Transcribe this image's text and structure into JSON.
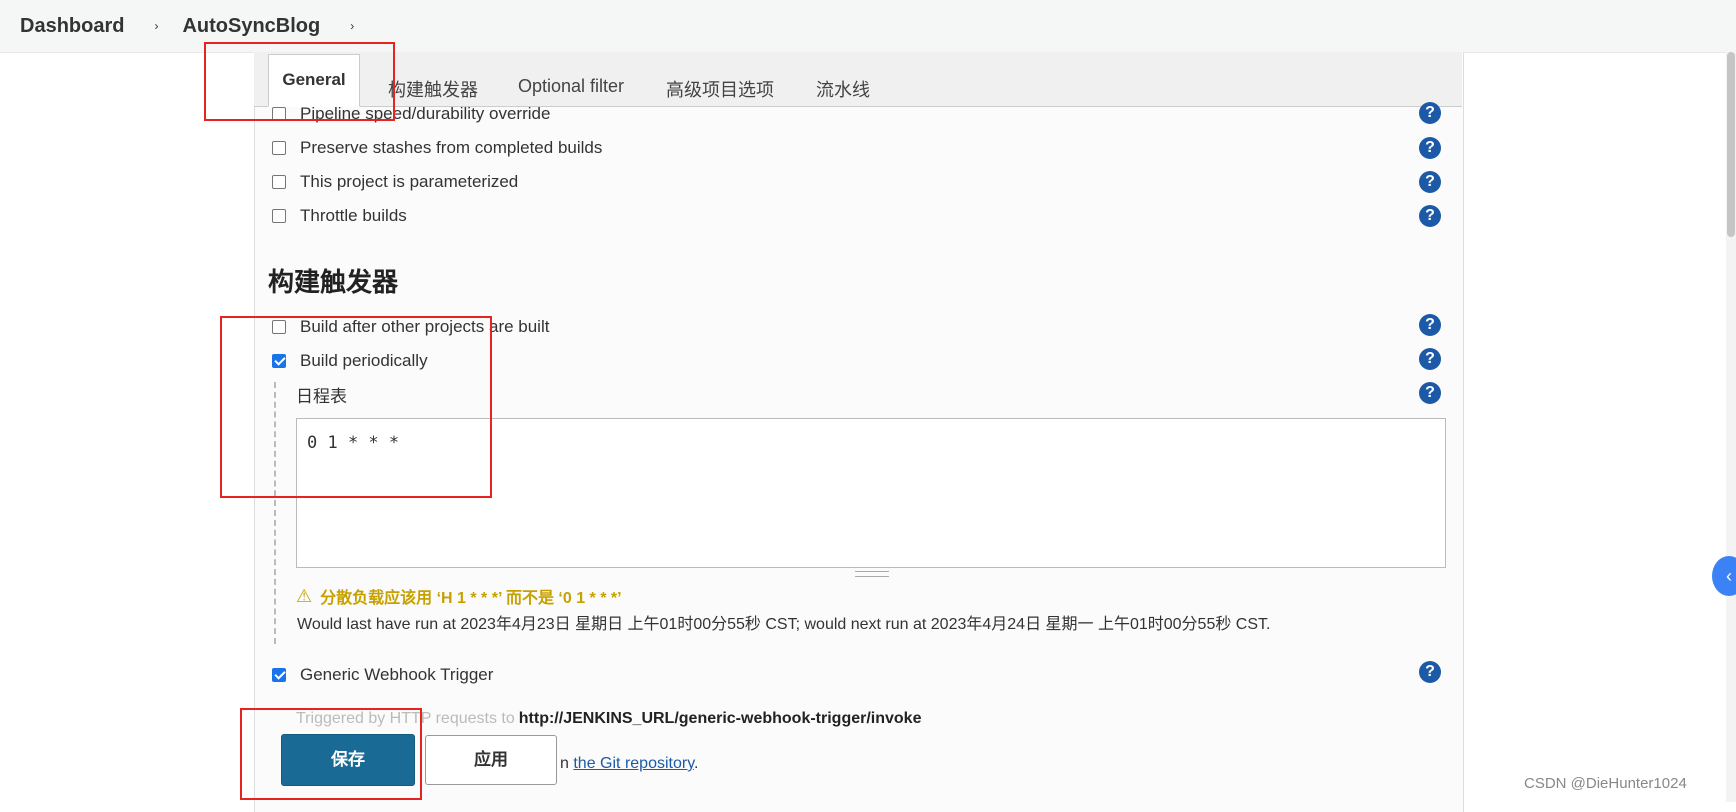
{
  "breadcrumb": {
    "root": "Dashboard",
    "job": "AutoSyncBlog",
    "separator": "›"
  },
  "tabs": [
    "General",
    "构建触发器",
    "Optional filter",
    "高级项目选项",
    "流水线"
  ],
  "general_options": [
    {
      "label": "Pipeline speed/durability override",
      "checked": false
    },
    {
      "label": "Preserve stashes from completed builds",
      "checked": false
    },
    {
      "label": "This project is parameterized",
      "checked": false
    },
    {
      "label": "Throttle builds",
      "checked": false
    }
  ],
  "triggers": {
    "title": "构建触发器",
    "build_after": {
      "label": "Build after other projects are built",
      "checked": false
    },
    "build_periodically": {
      "label": "Build periodically",
      "checked": true
    },
    "schedule_label": "日程表",
    "schedule_value": "0 1 * * *",
    "warning": "分散负载应该用 ‘H 1 * * *’ 而不是 ‘0 1 * * *’",
    "run_info": "Would last have run at 2023年4月23日 星期日 上午01时00分55秒 CST; would next run at 2023年4月24日 星期一 上午01时00分55秒 CST.",
    "generic_webhook": {
      "label": "Generic Webhook Trigger",
      "checked": true
    },
    "triggered_prefix": "Triggered by HTTP requests to",
    "webhook_url": "http://JENKINS_URL/generic-webhook-trigger/invoke",
    "git_prefix": "n",
    "git_link": "the Git repository",
    "git_suffix": "."
  },
  "buttons": {
    "save": "保存",
    "apply": "应用"
  },
  "icons": {
    "help": "?",
    "warning": "⚠",
    "float": "‹"
  },
  "watermark": "CSDN @DieHunter1024",
  "colors": {
    "accent": "#1a6a96",
    "help": "#1c5aa8",
    "highlight": "#e52420",
    "warning": "#c7a100"
  }
}
